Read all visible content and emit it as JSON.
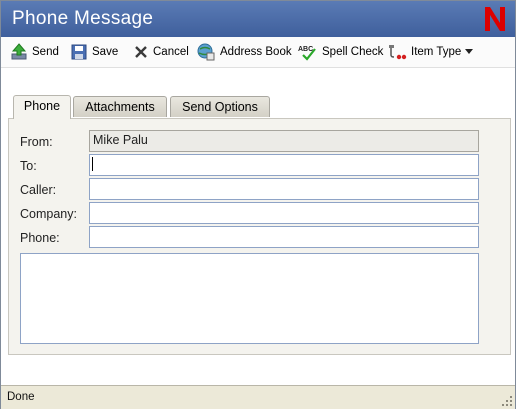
{
  "window": {
    "title": "Phone Message"
  },
  "logo": {
    "glyph": "N",
    "color": "#dd0000"
  },
  "toolbar": {
    "send": "Send",
    "save": "Save",
    "cancel": "Cancel",
    "address_book": "Address Book",
    "spell_check": "Spell Check",
    "item_type": "Item Type"
  },
  "tabs": [
    {
      "label": "Phone",
      "active": true
    },
    {
      "label": "Attachments",
      "active": false
    },
    {
      "label": "Send Options",
      "active": false
    }
  ],
  "form": {
    "from_label": "From:",
    "from_value": "Mike Palu",
    "to_label": "To:",
    "to_value": "",
    "caller_label": "Caller:",
    "caller_value": "",
    "company_label": "Company:",
    "company_value": "",
    "phone_label": "Phone:",
    "phone_value": "",
    "message_value": ""
  },
  "status": {
    "text": "Done"
  },
  "colors": {
    "titlebar": "#4a6aa8",
    "panel": "#f4f3ee",
    "field_border": "#8ea3c6"
  }
}
